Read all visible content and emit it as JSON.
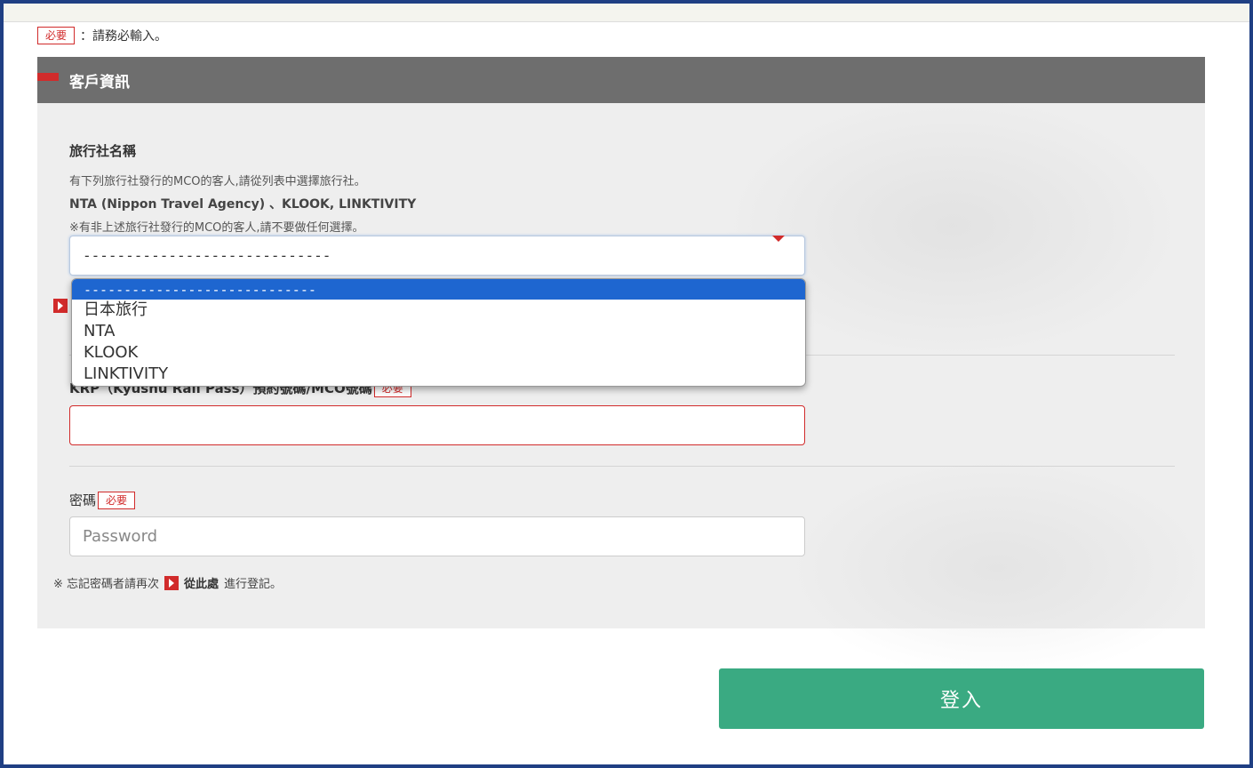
{
  "required_label": "必要",
  "required_note": "：請務必輸入。",
  "section": {
    "title": "客戶資訊"
  },
  "agency": {
    "label": "旅行社名稱",
    "help1": "有下列旅行社發行的MCO的客人,請從列表中選擇旅行社。",
    "help2": "NTA (Nippon Travel Agency) 、KLOOK, LINKTIVITY",
    "help3": "※有非上述旅行社發行的MCO的客人,請不要做任何選擇。",
    "selected": "-----------------------------",
    "options": [
      "-----------------------------",
      "日本旅行",
      "NTA",
      "KLOOK",
      "LINKTIVITY"
    ]
  },
  "krp": {
    "label": "KRP（Kyushu Rail Pass）預約號碼/MCO號碼",
    "value": ""
  },
  "password": {
    "label": "密碼",
    "placeholder": "Password",
    "value": ""
  },
  "forgot": {
    "prefix": "※ 忘記密碼者請再次",
    "link": "從此處",
    "suffix": "進行登記。"
  },
  "login_button": "登入",
  "colors": {
    "accent_red": "#d12b2b",
    "header_gray": "#6e6e6e",
    "button_green": "#3aaa82",
    "selection_blue": "#1e66d0",
    "frame_blue": "#1f3f83"
  }
}
